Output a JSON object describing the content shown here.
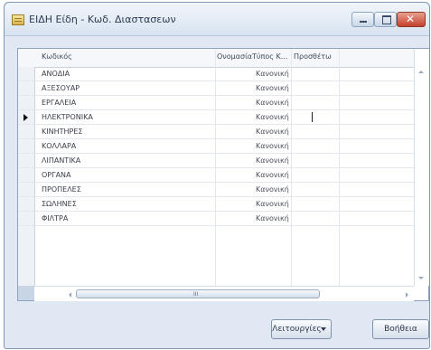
{
  "window": {
    "title": "ΕΙΔΗ Είδη - Κωδ. Διαστασεων"
  },
  "window_controls": {
    "close_symbol": "✕"
  },
  "grid": {
    "columns": [
      "Κωδικός",
      "Ονομασία",
      "Τύπος Κ...",
      "Προσθέτω"
    ],
    "rows": [
      {
        "code": "ΑΝΟΔΙΑ",
        "type": "Κανονική"
      },
      {
        "code": "ΑΞΕΣΟΥΑΡ",
        "type": "Κανονική"
      },
      {
        "code": "ΕΡΓΑΛΕΙΑ",
        "type": "Κανονική"
      },
      {
        "code": "ΗΛΕΚΤΡΟΝΙΚΑ",
        "type": "Κανονική",
        "current": true
      },
      {
        "code": "ΚΙΝΗΤΗΡΕΣ",
        "type": "Κανονική"
      },
      {
        "code": "ΚΟΛΛΑΡΑ",
        "type": "Κανονική"
      },
      {
        "code": "ΛΙΠΑΝΤΙΚΑ",
        "type": "Κανονική"
      },
      {
        "code": "ΟΡΓΑΝΑ",
        "type": "Κανονική"
      },
      {
        "code": "ΠΡΟΠΕΛΕΣ",
        "type": "Κανονική"
      },
      {
        "code": "ΣΩΛΗΝΕΣ",
        "type": "Κανονική"
      },
      {
        "code": "ΦΙΛΤΡΑ",
        "type": "Κανονική"
      }
    ],
    "scroll_thumb_grip": "III"
  },
  "footer": {
    "functions_label": "Λειτουργίες",
    "help_label": "Βοήθεια"
  },
  "icons": [
    "app-icon",
    "minimize-icon",
    "maximize-icon",
    "close-icon",
    "row-pointer-icon",
    "scroll-up-icon",
    "scroll-down-icon",
    "scroll-left-icon",
    "scroll-right-icon",
    "dropdown-arrow-icon"
  ]
}
